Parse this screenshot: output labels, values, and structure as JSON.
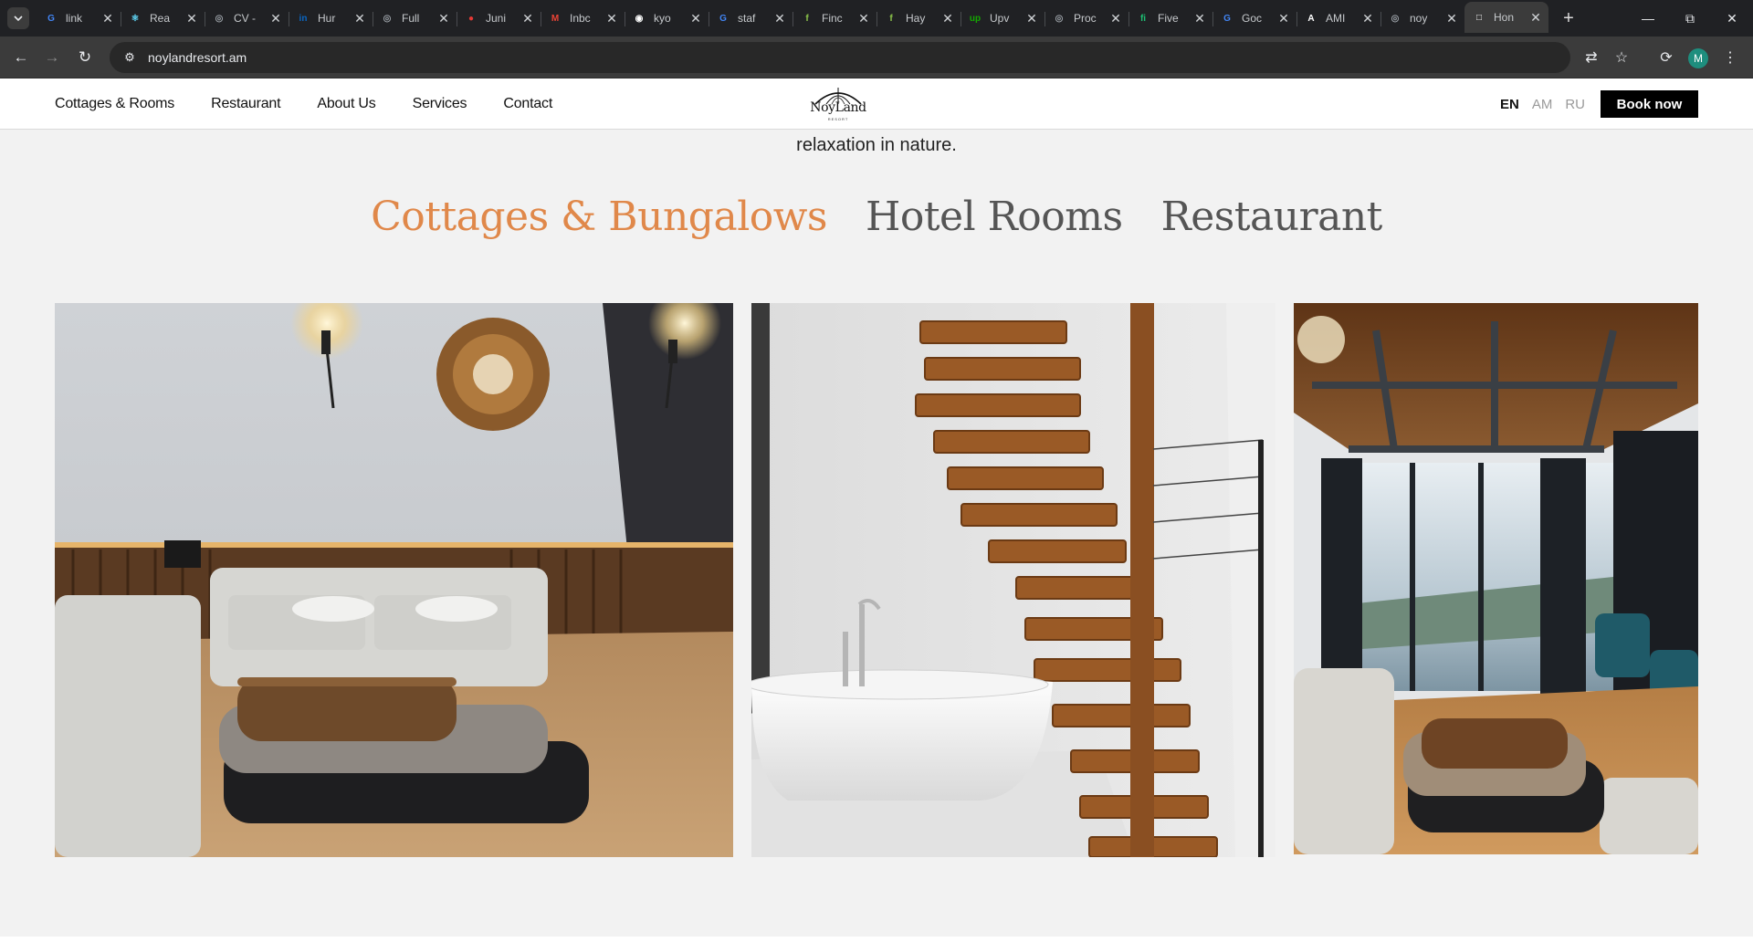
{
  "browser": {
    "tabs": [
      {
        "title": "link",
        "icon": "google-icon",
        "color": "#4285f4"
      },
      {
        "title": "Rea",
        "icon": "react-icon",
        "color": "#61dafb"
      },
      {
        "title": "CV -",
        "icon": "globe-icon",
        "color": "#9aa0a6"
      },
      {
        "title": "Hur",
        "icon": "linkedin-icon",
        "color": "#0a66c2"
      },
      {
        "title": "Full",
        "icon": "globe-icon",
        "color": "#9aa0a6"
      },
      {
        "title": "Juni",
        "icon": "record-icon",
        "color": "#e53935"
      },
      {
        "title": "Inbc",
        "icon": "gmail-icon",
        "color": "#ea4335"
      },
      {
        "title": "kyo",
        "icon": "github-icon",
        "color": "#ffffff"
      },
      {
        "title": "staf",
        "icon": "google-icon",
        "color": "#4285f4"
      },
      {
        "title": "Finc",
        "icon": "find-icon",
        "color": "#8bc34a"
      },
      {
        "title": "Hay",
        "icon": "find-icon",
        "color": "#8bc34a"
      },
      {
        "title": "Upv",
        "icon": "upwork-icon",
        "color": "#14a800"
      },
      {
        "title": "Proc",
        "icon": "globe-icon",
        "color": "#9aa0a6"
      },
      {
        "title": "Five",
        "icon": "fiverr-icon",
        "color": "#1dbf73"
      },
      {
        "title": "Goc",
        "icon": "translate-icon",
        "color": "#4285f4"
      },
      {
        "title": "AMI",
        "icon": "a-icon",
        "color": "#ffffff"
      },
      {
        "title": "noy",
        "icon": "globe-icon",
        "color": "#9aa0a6"
      },
      {
        "title": "Hon",
        "icon": "page-icon",
        "color": "#ffffff",
        "active": true
      }
    ],
    "url": "noylandresort.am",
    "profile_initial": "M"
  },
  "header": {
    "nav": [
      "Cottages & Rooms",
      "Restaurant",
      "About Us",
      "Services",
      "Contact"
    ],
    "logo_text": "NoyLand",
    "logo_sub": "RESORT",
    "languages": [
      {
        "code": "EN",
        "active": true
      },
      {
        "code": "AM",
        "active": false
      },
      {
        "code": "RU",
        "active": false
      }
    ],
    "book_label": "Book now"
  },
  "intro": {
    "last_line": "relaxation in nature."
  },
  "categories": [
    {
      "label": "Cottages & Bungalows",
      "active": true
    },
    {
      "label": "Hotel Rooms",
      "active": false
    },
    {
      "label": "Restaurant",
      "active": false
    }
  ],
  "colors": {
    "accent": "#e0884a",
    "page_bg": "#f2f2f2",
    "book_bg": "#000000"
  }
}
